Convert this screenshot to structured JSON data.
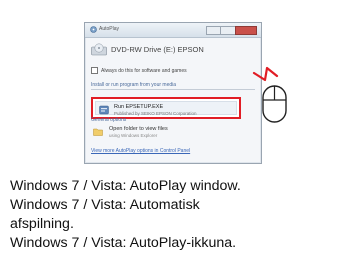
{
  "autoplay": {
    "window_title": "AutoPlay",
    "drive_label": "DVD-RW Drive (E:) EPSON",
    "checkbox_label": "Always do this for software and games",
    "install_section": "Install or run program from your media",
    "run_label": "Run EPSETUP.EXE",
    "run_publisher": "Published by SEIKO EPSON Corporation",
    "general_section": "General options",
    "open_folder_label": "Open folder to view files",
    "open_folder_sub": "using Windows Explorer",
    "control_panel_link": "View more AutoPlay options in Control Panel"
  },
  "captions": [
    "Windows 7 / Vista: AutoPlay window.",
    "Windows 7 / Vista: Automatisk",
    "afspilning.",
    "Windows 7 / Vista: AutoPlay-ikkuna."
  ],
  "colors": {
    "highlight_frame": "#e11d25",
    "click_mark": "#e11d25"
  }
}
